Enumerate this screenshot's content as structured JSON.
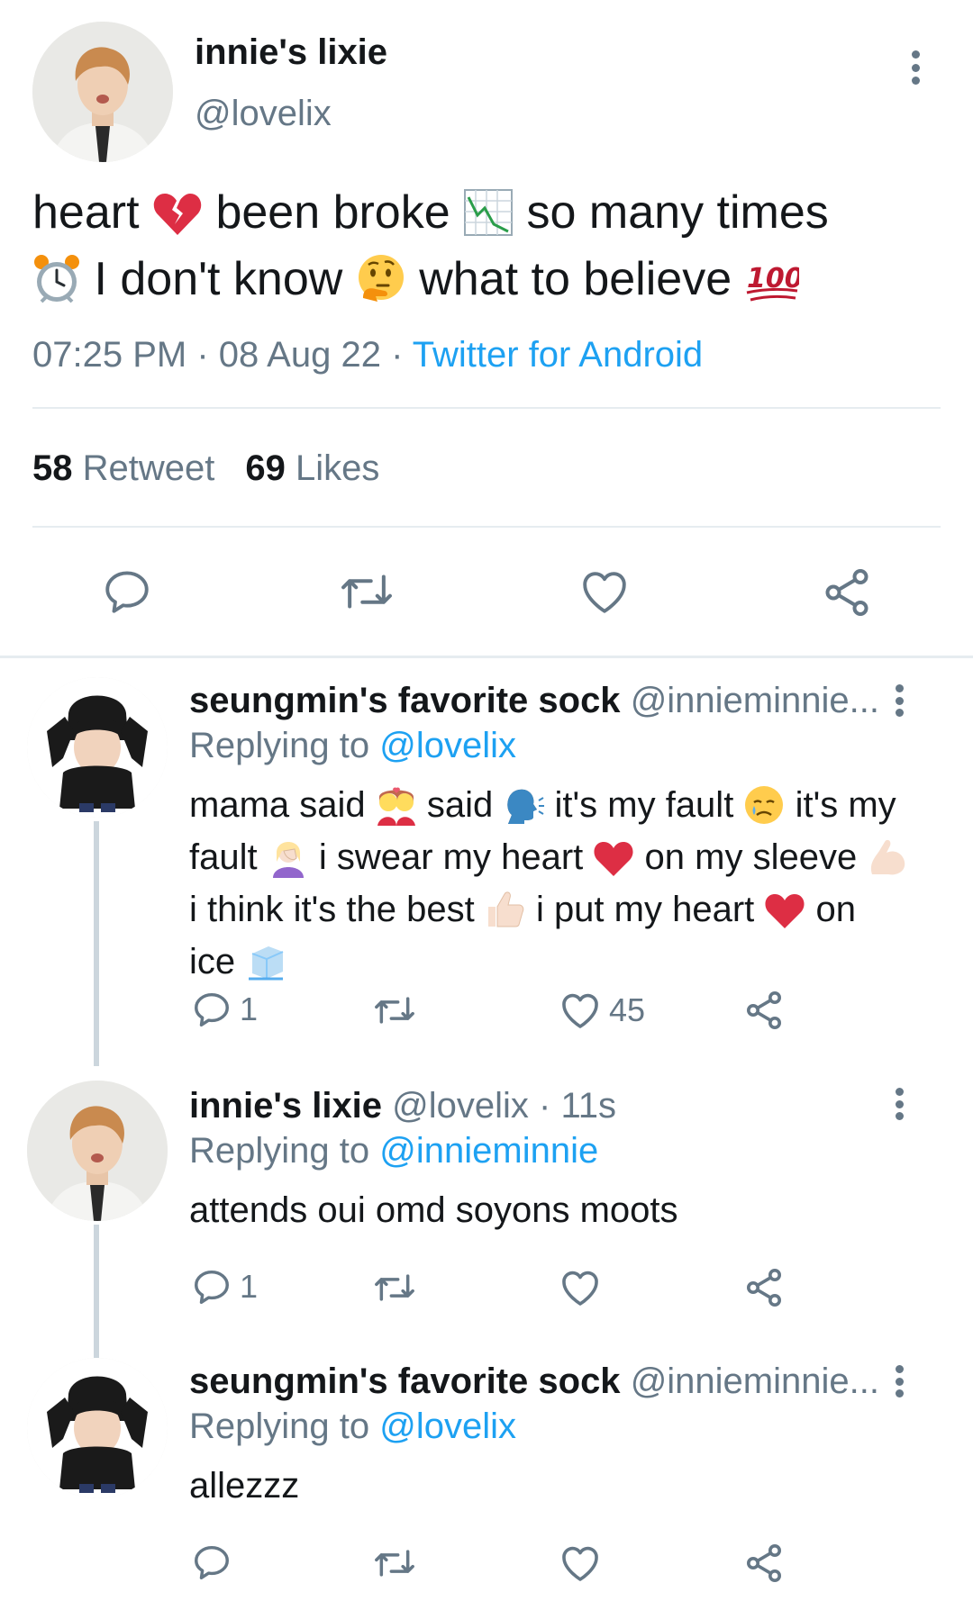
{
  "tweet": {
    "author_name": "innie's lixie",
    "author_handle": "@lovelix",
    "text_parts": {
      "p1": "heart",
      "p2": "been broke",
      "p3": "so many times",
      "p4": "I don't know",
      "p5": "what to believe"
    },
    "emojis": [
      "broken-heart-icon",
      "chart-decreasing-icon",
      "alarm-clock-icon",
      "thinking-face-icon",
      "hundred-points-icon"
    ],
    "time": "07:25 PM",
    "sep": " · ",
    "date": "08 Aug 22",
    "source": "Twitter for Android",
    "retweets_count": "58",
    "retweets_label": "Retweet",
    "likes_count": "69",
    "likes_label": "Likes"
  },
  "replies": [
    {
      "author_name": "seungmin's favorite sock",
      "author_handle": "@innieminnie...",
      "replying_prefix": "Replying to",
      "replying_to": "@lovelix",
      "text": {
        "a": "mama said",
        "b": "said",
        "c": "it's my fault",
        "d": "it's my fault",
        "e": "i swear my heart",
        "f": "on my sleeve",
        "g": "i think it's the best",
        "h": "i put my heart",
        "i": "on ice"
      },
      "reply_count": "1",
      "like_count": "45"
    },
    {
      "author_name": "innie's lixie",
      "author_handle": "@lovelix · 11s",
      "replying_prefix": "Replying to",
      "replying_to": "@innieminnie",
      "text": "attends oui omd soyons moots",
      "reply_count": "1"
    },
    {
      "author_name": "seungmin's favorite sock",
      "author_handle": "@innieminnie...",
      "replying_prefix": "Replying to",
      "replying_to": "@lovelix",
      "text": "allezzz"
    }
  ],
  "colors": {
    "accent": "#1da1f2",
    "muted": "#657786",
    "text": "#14171a",
    "divider": "#e6ecf0",
    "thread_line": "#ccd6dd"
  }
}
